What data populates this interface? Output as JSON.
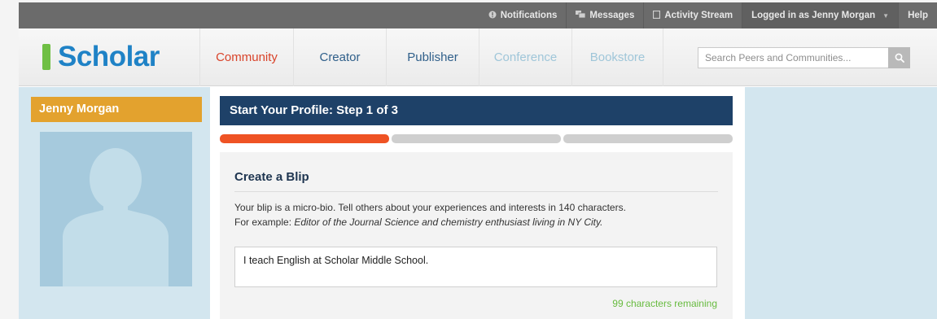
{
  "topbar": {
    "notifications": "Notifications",
    "messages": "Messages",
    "activity_stream": "Activity Stream",
    "logged_in": "Logged in as Jenny Morgan",
    "help": "Help"
  },
  "brand": {
    "name": "Scholar",
    "color": "#1f82c6",
    "mark_color": "#6fbf44"
  },
  "nav": {
    "community": "Community",
    "creator": "Creator",
    "publisher": "Publisher",
    "conference": "Conference",
    "bookstore": "Bookstore"
  },
  "search": {
    "placeholder": "Search Peers and Communities..."
  },
  "profile": {
    "name": "Jenny Morgan"
  },
  "step": {
    "title": "Start Your Profile: Step 1 of 3",
    "progress_steps_done": 1,
    "progress_steps_total": 3
  },
  "blip": {
    "title": "Create a Blip",
    "desc_line1": "Your blip is a micro-bio. Tell others about your experiences and interests in 140 characters.",
    "desc_prefix": "For example: ",
    "desc_example": "Editor of the Journal Science and chemistry enthusiast living in NY City.",
    "value": "I teach English at Scholar Middle School.",
    "remaining": "99 characters remaining"
  },
  "colors": {
    "header_navy": "#1e4168",
    "accent_orange": "#ef5324",
    "name_banner": "#e3a22e",
    "success_green": "#67bb3f"
  }
}
